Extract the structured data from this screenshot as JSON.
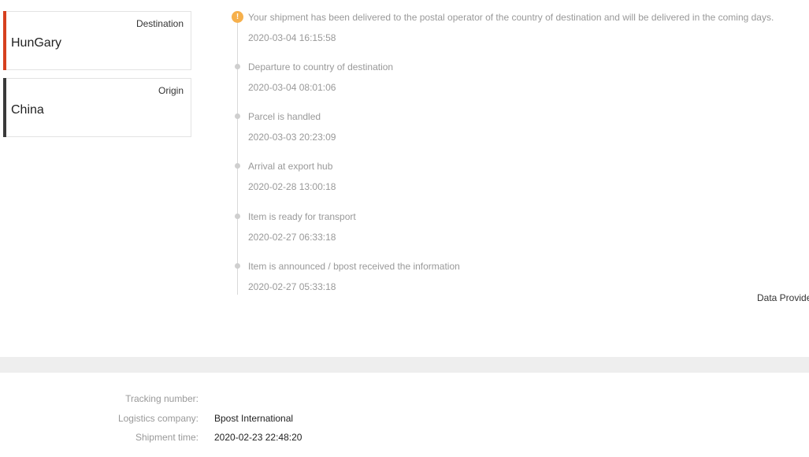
{
  "colors": {
    "destination_bar": "#d6401e",
    "origin_bar": "#3a3a3a",
    "latest_dot": "#f6b04c"
  },
  "destination": {
    "label": "Destination",
    "country": "HunGary"
  },
  "origin": {
    "label": "Origin",
    "country": "China"
  },
  "timeline": {
    "latest_icon": "!",
    "events": [
      {
        "description": "Your shipment has been delivered to the postal operator of the country of destination and will be delivered in the coming days.",
        "time": "2020-03-04 16:15:58"
      },
      {
        "description": "Departure to country of destination",
        "time": "2020-03-04 08:01:06"
      },
      {
        "description": "Parcel is handled",
        "time": "2020-03-03 20:23:09"
      },
      {
        "description": "Arrival at export hub",
        "time": "2020-02-28 13:00:18"
      },
      {
        "description": "Item is ready for transport",
        "time": "2020-02-27 06:33:18"
      },
      {
        "description": "Item is announced / bpost received the information",
        "time": "2020-02-27 05:33:18"
      }
    ]
  },
  "provider_text": "Data Provide",
  "details": {
    "tracking_number_label": "Tracking number:",
    "tracking_number_value": "",
    "logistics_company_label": "Logistics company:",
    "logistics_company_value": "Bpost International",
    "shipment_time_label": "Shipment time:",
    "shipment_time_value": "2020-02-23 22:48:20"
  }
}
